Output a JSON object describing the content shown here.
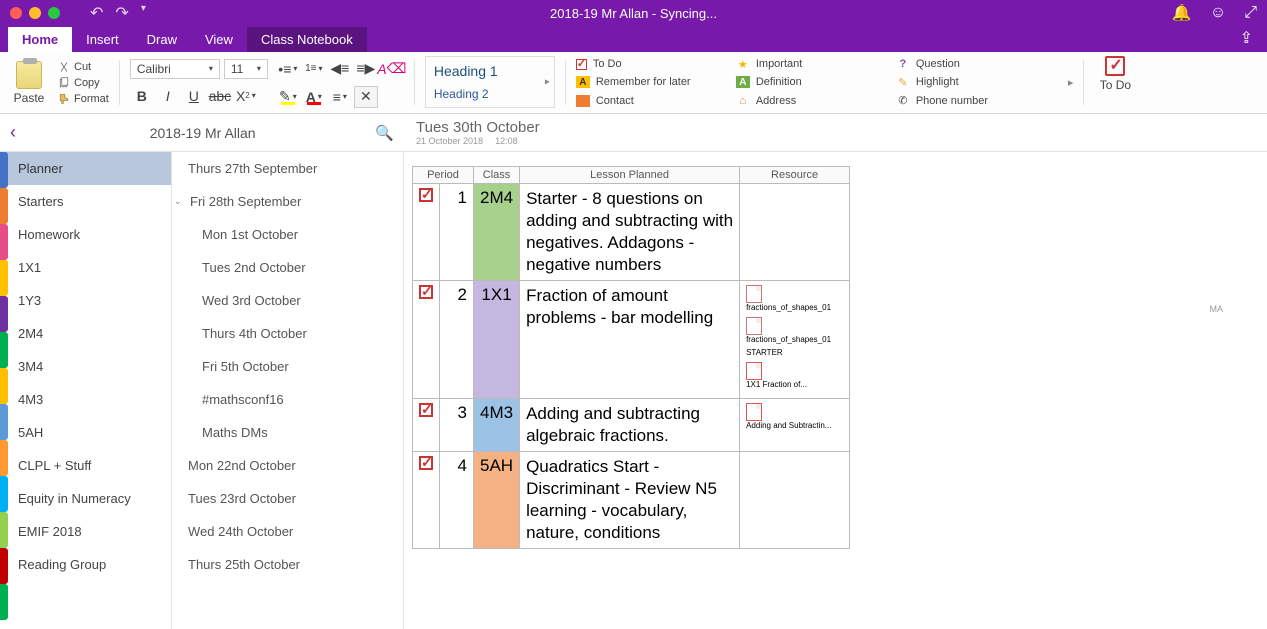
{
  "window": {
    "title": "2018-19 Mr Allan - Syncing..."
  },
  "tabs": {
    "home": "Home",
    "insert": "Insert",
    "draw": "Draw",
    "view": "View",
    "classnb": "Class Notebook"
  },
  "ribbon": {
    "paste": "Paste",
    "cut": "Cut",
    "copy": "Copy",
    "format": "Format",
    "font": "Calibri",
    "size": "11",
    "styles": {
      "h1": "Heading 1",
      "h2": "Heading 2"
    },
    "tags": {
      "todo": "To Do",
      "remember": "Remember for later",
      "contact": "Contact",
      "important": "Important",
      "definition": "Definition",
      "address": "Address",
      "question": "Question",
      "highlight": "Highlight",
      "phone": "Phone number"
    },
    "todo_label": "To Do"
  },
  "notebook": {
    "name": "2018-19 Mr Allan"
  },
  "sections": [
    {
      "label": "Planner",
      "active": true,
      "color": "#4472c4"
    },
    {
      "label": "Starters",
      "color": "#ed7d31"
    },
    {
      "label": "Homework",
      "color": "#e84c88"
    },
    {
      "label": "1X1",
      "color": "#ffc000"
    },
    {
      "label": "1Y3",
      "color": "#6f30a0"
    },
    {
      "label": "2M4",
      "color": "#00b050"
    },
    {
      "label": "3M4",
      "color": "#ffbf00"
    },
    {
      "label": "4M3",
      "color": "#5b9bd5"
    },
    {
      "label": "5AH",
      "color": "#ff9933"
    },
    {
      "label": "CLPL + Stuff",
      "color": "#00b0f0"
    },
    {
      "label": "Equity in Numeracy",
      "color": "#92d050"
    },
    {
      "label": "EMIF 2018",
      "color": "#c00000"
    },
    {
      "label": "Reading Group",
      "color": "#00b050"
    }
  ],
  "pages": [
    {
      "label": "Thurs 27th September",
      "sub": false
    },
    {
      "label": "Fri 28th September",
      "sub": false,
      "expanded": true
    },
    {
      "label": "Mon 1st October",
      "sub": true
    },
    {
      "label": "Tues 2nd October",
      "sub": true
    },
    {
      "label": "Wed 3rd October",
      "sub": true
    },
    {
      "label": "Thurs 4th October",
      "sub": true
    },
    {
      "label": "Fri 5th October",
      "sub": true
    },
    {
      "label": "#mathsconf16",
      "sub": true
    },
    {
      "label": "Maths DMs",
      "sub": true
    },
    {
      "label": "Mon 22nd October",
      "sub": false
    },
    {
      "label": "Tues 23rd October",
      "sub": false
    },
    {
      "label": "Wed 24th October",
      "sub": false
    },
    {
      "label": "Thurs 25th October",
      "sub": false
    }
  ],
  "page": {
    "title": "Tues 30th October",
    "date": "21 October 2018",
    "time": "12:08",
    "headers": {
      "period": "Period",
      "class": "Class",
      "lesson": "Lesson Planned",
      "resource": "Resource"
    },
    "rows": [
      {
        "period": "1",
        "class": "2M4",
        "classColor": "c-2m4",
        "lesson": "Starter - 8 questions on adding and subtracting with negatives.\nAddagons - negative numbers",
        "resources": []
      },
      {
        "period": "2",
        "class": "1X1",
        "classColor": "c-1x1",
        "lesson": "Fraction of amount problems - bar modelling",
        "resources": [
          {
            "name": "fractions_of_shapes_01",
            "type": "pdf"
          },
          {
            "name": "fractions_of_shapes_01",
            "type": "pdf"
          },
          {
            "name": "STARTER",
            "type": "text"
          },
          {
            "name": "1X1 Fraction of...",
            "type": "ppt"
          }
        ]
      },
      {
        "period": "3",
        "class": "4M3",
        "classColor": "c-4m3",
        "lesson": "Adding and subtracting algebraic fractions.",
        "resources": [
          {
            "name": "Adding and Subtractin...",
            "type": "ppt"
          }
        ]
      },
      {
        "period": "4",
        "class": "5AH",
        "classColor": "c-5ah",
        "lesson": "Quadratics Start - Discriminant - Review N5 learning - vocabulary, nature, conditions",
        "resources": []
      }
    ]
  },
  "misc": {
    "ma": "MA"
  }
}
